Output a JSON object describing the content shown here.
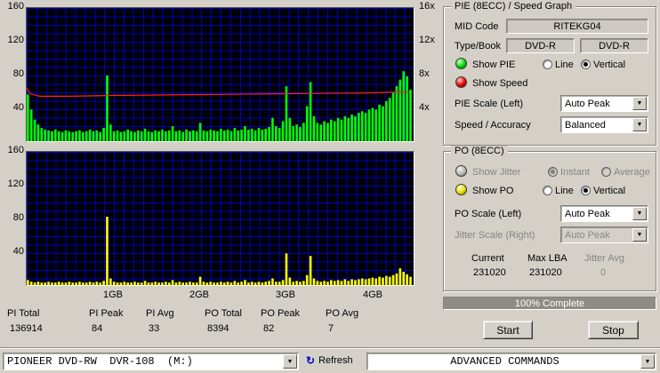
{
  "icons": {
    "dropdown_arrow": "▼",
    "refresh": "↻"
  },
  "colors": {
    "pie_trace": "#00ff00",
    "po_trace": "#ffff00",
    "speed_line": "#ff2020",
    "grid": "#0000b4",
    "plot_bg": "#000008",
    "dialog_bg": "#d4d0c8",
    "led_green": "#00cc00",
    "led_red": "#dd0000",
    "led_yellow": "#e6e600"
  },
  "chart_data": {
    "type": "area",
    "x_axis": {
      "label_unit": "GB",
      "max_gb": 4.49,
      "tick_labels": [
        "1GB",
        "2GB",
        "3GB",
        "4GB"
      ],
      "tick_gb": [
        1,
        2,
        3,
        4
      ]
    },
    "pie_graph": {
      "title": "PIE (8ECC) / Speed Graph",
      "y_max": 160,
      "y_tick_labels": [
        "160",
        "120",
        "80",
        "40"
      ],
      "speed_tick_labels": [
        "16x",
        "12x",
        "8x",
        "4x"
      ],
      "sample_step_gb": 0.04,
      "pie_values": [
        56,
        38,
        26,
        20,
        16,
        14,
        13,
        12,
        14,
        12,
        11,
        13,
        12,
        11,
        12,
        13,
        11,
        12,
        14,
        12,
        13,
        11,
        16,
        79,
        20,
        12,
        13,
        11,
        12,
        14,
        12,
        11,
        13,
        12,
        15,
        12,
        11,
        13,
        12,
        14,
        12,
        13,
        18,
        12,
        13,
        11,
        14,
        12,
        13,
        12,
        22,
        13,
        12,
        14,
        13,
        12,
        15,
        13,
        14,
        12,
        16,
        13,
        14,
        18,
        14,
        15,
        13,
        16,
        14,
        15,
        17,
        28,
        18,
        16,
        24,
        66,
        28,
        18,
        20,
        17,
        22,
        42,
        71,
        30,
        22,
        20,
        24,
        22,
        26,
        24,
        28,
        26,
        30,
        28,
        32,
        30,
        34,
        36,
        34,
        38,
        40,
        38,
        44,
        42,
        48,
        52,
        58,
        66,
        74,
        84,
        78,
        62
      ],
      "speed_line_points": [
        [
          0,
          64
        ],
        [
          0.04,
          57
        ],
        [
          0.15,
          54
        ],
        [
          0.5,
          54
        ],
        [
          1,
          55
        ],
        [
          2,
          56
        ],
        [
          3,
          57
        ],
        [
          4,
          58
        ],
        [
          4.3,
          59
        ],
        [
          4.44,
          59
        ]
      ]
    },
    "po_graph": {
      "title": "PO (8ECC)",
      "y_max": 160,
      "y_tick_labels": [
        "160",
        "120",
        "80",
        "40"
      ],
      "sample_step_gb": 0.04,
      "po_values": [
        6,
        4,
        3,
        4,
        3,
        3,
        4,
        3,
        3,
        4,
        3,
        3,
        4,
        3,
        3,
        4,
        3,
        3,
        4,
        3,
        4,
        3,
        5,
        82,
        8,
        4,
        3,
        3,
        4,
        3,
        3,
        4,
        3,
        3,
        5,
        3,
        3,
        4,
        3,
        3,
        4,
        3,
        6,
        3,
        4,
        3,
        3,
        4,
        3,
        3,
        10,
        4,
        3,
        4,
        3,
        3,
        4,
        3,
        4,
        3,
        5,
        3,
        4,
        6,
        3,
        4,
        3,
        4,
        3,
        4,
        5,
        8,
        4,
        4,
        6,
        38,
        9,
        4,
        5,
        4,
        5,
        12,
        35,
        8,
        5,
        4,
        5,
        4,
        6,
        5,
        6,
        5,
        7,
        5,
        7,
        6,
        7,
        8,
        7,
        8,
        9,
        8,
        10,
        9,
        11,
        10,
        12,
        14,
        20,
        16,
        13,
        10
      ]
    }
  },
  "stats": {
    "items": [
      {
        "label": "PI Total",
        "value": "136914"
      },
      {
        "label": "PI Peak",
        "value": "84"
      },
      {
        "label": "PI Avg",
        "value": "33"
      },
      {
        "label": "PO Total",
        "value": "8394"
      },
      {
        "label": "PO Peak",
        "value": "82"
      },
      {
        "label": "PO Avg",
        "value": "7"
      }
    ]
  },
  "pie_panel": {
    "title": "PIE (8ECC) / Speed Graph",
    "mid_code_label": "MID Code",
    "mid_code_value": "RITEKG04",
    "type_book_label": "Type/Book",
    "type_value": "DVD-R",
    "book_value": "DVD-R",
    "show_pie_label": "Show PIE",
    "line_label": "Line",
    "vertical_label": "Vertical",
    "show_speed_label": "Show Speed",
    "pie_scale_label": "PIE Scale (Left)",
    "pie_scale_value": "Auto Peak",
    "speed_accuracy_label": "Speed / Accuracy",
    "speed_accuracy_value": "Balanced"
  },
  "po_panel": {
    "title": "PO (8ECC)",
    "show_jitter_label": "Show Jitter",
    "instant_label": "Instant",
    "average_label": "Average",
    "show_po_label": "Show PO",
    "line_label": "Line",
    "vertical_label": "Vertical",
    "po_scale_label": "PO Scale (Left)",
    "po_scale_value": "Auto Peak",
    "jitter_scale_label": "Jitter Scale (Right)",
    "jitter_scale_value": "Auto Peak",
    "current_label": "Current",
    "current_value": "231020",
    "max_lba_label": "Max LBA",
    "max_lba_value": "231020",
    "jitter_avg_label": "Jitter Avg",
    "jitter_avg_value": "0"
  },
  "progress": {
    "text": "100% Complete"
  },
  "buttons": {
    "start": "Start",
    "stop": "Stop"
  },
  "bottom_bar": {
    "drive": "PIONEER DVD-RW  DVR-108  (M:)",
    "refresh": "Refresh",
    "commands": "ADVANCED COMMANDS"
  }
}
